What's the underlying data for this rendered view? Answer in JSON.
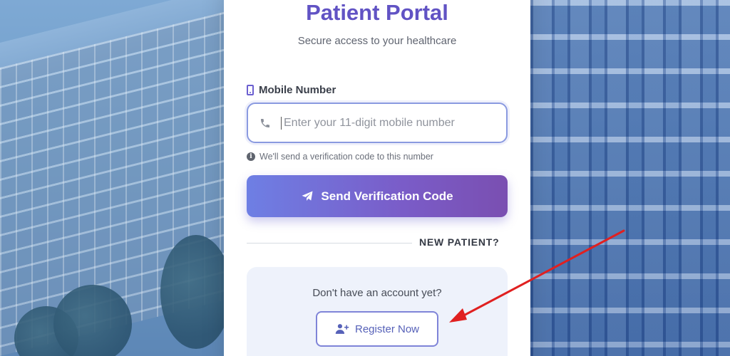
{
  "header": {
    "title": "Patient Portal",
    "subtitle": "Secure access to your healthcare"
  },
  "form": {
    "mobile_label": "Mobile Number",
    "mobile_placeholder": "Enter your 11-digit mobile number",
    "mobile_value": "",
    "hint": "We'll send a verification code to this number",
    "send_button_label": "Send Verification Code"
  },
  "divider": {
    "label": "NEW PATIENT?"
  },
  "register": {
    "question": "Don't have an account yet?",
    "button_label": "Register Now"
  },
  "icons": {
    "label_icon": "mobile-phone-icon",
    "input_icon": "phone-handset-icon",
    "hint_icon": "info-icon",
    "send_icon": "paper-plane-icon",
    "register_icon": "user-plus-icon"
  },
  "colors": {
    "title": "#6153c4",
    "accent_start": "#6e7fe4",
    "accent_end": "#7a4fb1",
    "annotation_arrow": "#e02020"
  }
}
